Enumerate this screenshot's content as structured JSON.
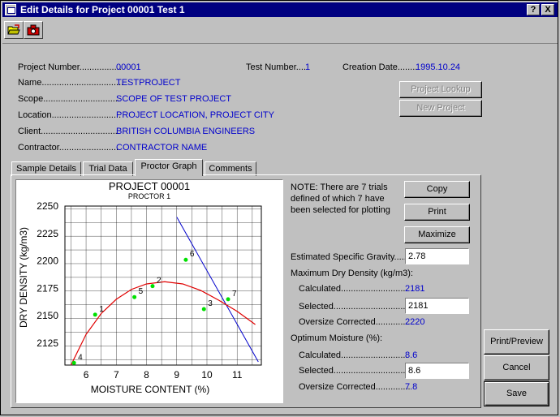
{
  "window": {
    "title": "Edit Details for Project 00001 Test 1",
    "help_label": "?",
    "close_label": "X"
  },
  "toolbar": {
    "icons": [
      "open-folder-icon",
      "camera-icon"
    ]
  },
  "project": {
    "number_label": "Project Number.................",
    "number_value": "00001",
    "test_label": "Test Number....",
    "test_value": "1",
    "date_label": "Creation Date........",
    "date_value": "1995.10.24",
    "name_label": "Name.................................",
    "name_value": "TESTPROJECT",
    "scope_label": "Scope...............................",
    "scope_value": "SCOPE OF TEST PROJECT",
    "location_label": "Location............................",
    "location_value": "PROJECT LOCATION, PROJECT CITY",
    "client_label": "Client...............................",
    "client_value": "BRITISH COLUMBIA ENGINEERS",
    "contractor_label": "Contractor........................",
    "contractor_value": "CONTRACTOR NAME",
    "lookup_label": "Project Lookup",
    "new_label": "New Project"
  },
  "tabs": [
    "Sample Details",
    "Trial Data",
    "Proctor Graph",
    "Comments"
  ],
  "proctor": {
    "note": "NOTE: There are 7 trials defined of which 7 have been selected for plotting",
    "copy_label": "Copy",
    "print_label": "Print",
    "maximize_label": "Maximize",
    "esg_label": "Estimated Specific Gravity......",
    "esg_value": "2.78",
    "mdd_label": "Maximum Dry Density (kg/m3):",
    "calc_label": "Calculated...........................",
    "mdd_calc": "2181",
    "sel_label": "Selected..............................",
    "mdd_sel": "2181",
    "over_label": "Oversize Corrected..............",
    "mdd_over": "2220",
    "om_label": "Optimum Moisture (%):",
    "om_calc": "8.6",
    "om_sel": "8.6",
    "om_over": "7.8"
  },
  "actions": {
    "print_preview": "Print/Preview",
    "cancel": "Cancel",
    "save": "Save"
  },
  "chart_data": {
    "type": "scatter",
    "title": "PROJECT 00001",
    "subtitle": "PROCTOR 1",
    "xlabel": "MOISTURE CONTENT (%)",
    "ylabel": "DRY DENSITY (kg/m3)",
    "xlim": [
      5.3,
      11.8
    ],
    "ylim": [
      2105,
      2250
    ],
    "xticks": [
      6,
      7,
      8,
      9,
      10,
      11
    ],
    "yticks": [
      2125,
      2150,
      2175,
      2200,
      2225,
      2250
    ],
    "grid": true,
    "points": [
      {
        "label": "1",
        "x": 6.3,
        "y": 2151
      },
      {
        "label": "2",
        "x": 8.2,
        "y": 2177
      },
      {
        "label": "3",
        "x": 9.9,
        "y": 2156
      },
      {
        "label": "4",
        "x": 5.6,
        "y": 2107
      },
      {
        "label": "5",
        "x": 7.6,
        "y": 2167
      },
      {
        "label": "6",
        "x": 9.3,
        "y": 2201
      },
      {
        "label": "7",
        "x": 10.7,
        "y": 2165
      }
    ],
    "curve": [
      [
        5.5,
        2105
      ],
      [
        6.0,
        2133
      ],
      [
        6.5,
        2152
      ],
      [
        7.0,
        2165
      ],
      [
        7.5,
        2174
      ],
      [
        8.0,
        2179
      ],
      [
        8.6,
        2181
      ],
      [
        9.2,
        2179
      ],
      [
        9.8,
        2173
      ],
      [
        10.4,
        2164
      ],
      [
        11.0,
        2154
      ],
      [
        11.6,
        2142
      ]
    ],
    "zav_line": [
      [
        9.0,
        2240
      ],
      [
        11.7,
        2108
      ]
    ],
    "colors": {
      "points": "#00e000",
      "curve": "#e00000",
      "zav": "#0000cc"
    }
  }
}
